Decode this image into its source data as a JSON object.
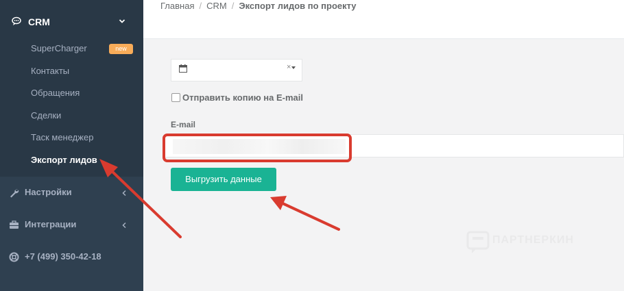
{
  "sidebar": {
    "crm": {
      "label": "CRM"
    },
    "crm_items": [
      {
        "label": "SuperCharger",
        "badge": "new"
      },
      {
        "label": "Контакты"
      },
      {
        "label": "Обращения"
      },
      {
        "label": "Сделки"
      },
      {
        "label": "Таск менеджер"
      },
      {
        "label": "Экспорт лидов",
        "active": true
      }
    ],
    "items": [
      {
        "label": "Настройки",
        "icon": "wrench-icon"
      },
      {
        "label": "Интеграции",
        "icon": "briefcase-icon"
      },
      {
        "label": "+7 (499) 350-42-18",
        "icon": "lifebuoy-icon"
      }
    ]
  },
  "breadcrumb": {
    "home": "Главная",
    "section": "CRM",
    "current": "Экспорт лидов по проекту"
  },
  "form": {
    "date_clear": "×",
    "copy_checkbox_label": "Отправить копию на E-mail",
    "copy_checked": false,
    "email_label": "E-mail",
    "email_value": "",
    "submit_label": "Выгрузить данные"
  },
  "watermark": {
    "text": "ПАРТНЕРКИН"
  },
  "colors": {
    "sidebar": "#2f4050",
    "sidebar_submenu": "#293846",
    "primary": "#1ab394",
    "badge": "#f8ac59",
    "annotation": "#d93b2f"
  }
}
